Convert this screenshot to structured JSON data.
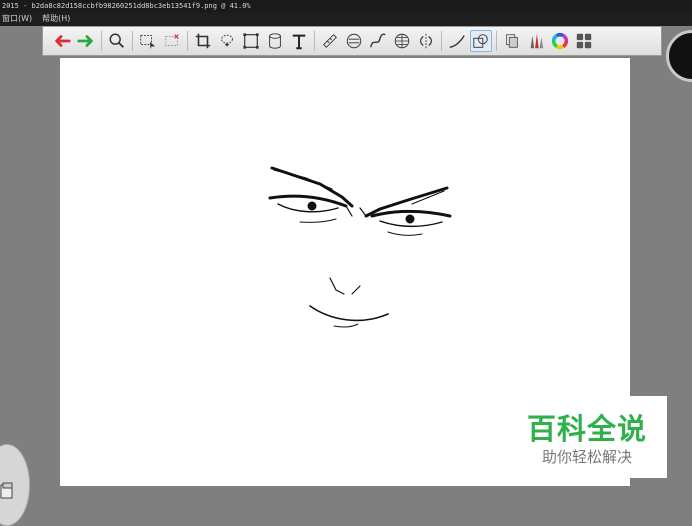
{
  "window": {
    "title": "2015 - b2da8c82d158ccbfb98260251dd8bc3eb13541f9.png @ 41.0%"
  },
  "menu": {
    "items": [
      "窗口(W)",
      "帮助(H)"
    ]
  },
  "toolbar": {
    "tools": [
      {
        "name": "undo-icon",
        "color": "#d83030"
      },
      {
        "name": "redo-icon",
        "color": "#2aa83a"
      },
      {
        "name": "zoom-icon"
      },
      {
        "name": "marquee-select-icon"
      },
      {
        "name": "clear-selection-icon"
      },
      {
        "name": "crop-icon"
      },
      {
        "name": "lasso-icon"
      },
      {
        "name": "transform-icon"
      },
      {
        "name": "cylinder-icon"
      },
      {
        "name": "text-icon"
      },
      {
        "name": "ruler-icon"
      },
      {
        "name": "ellipse-ruler-icon"
      },
      {
        "name": "curve-ruler-icon"
      },
      {
        "name": "perspective-ruler-icon"
      },
      {
        "name": "symmetry-icon"
      },
      {
        "name": "stroke-icon"
      },
      {
        "name": "layer-icon",
        "active": true
      },
      {
        "name": "stamp-icon"
      },
      {
        "name": "brushes-icon"
      },
      {
        "name": "color-wheel-icon"
      },
      {
        "name": "palette-grid-icon"
      }
    ]
  },
  "watermark": {
    "title": "百科全说",
    "subtitle": "助你轻松解决",
    "color": "#2fb04a"
  },
  "colors": {
    "workspace": "#7f7f7f",
    "canvas": "#ffffff",
    "ink": "#111111"
  }
}
